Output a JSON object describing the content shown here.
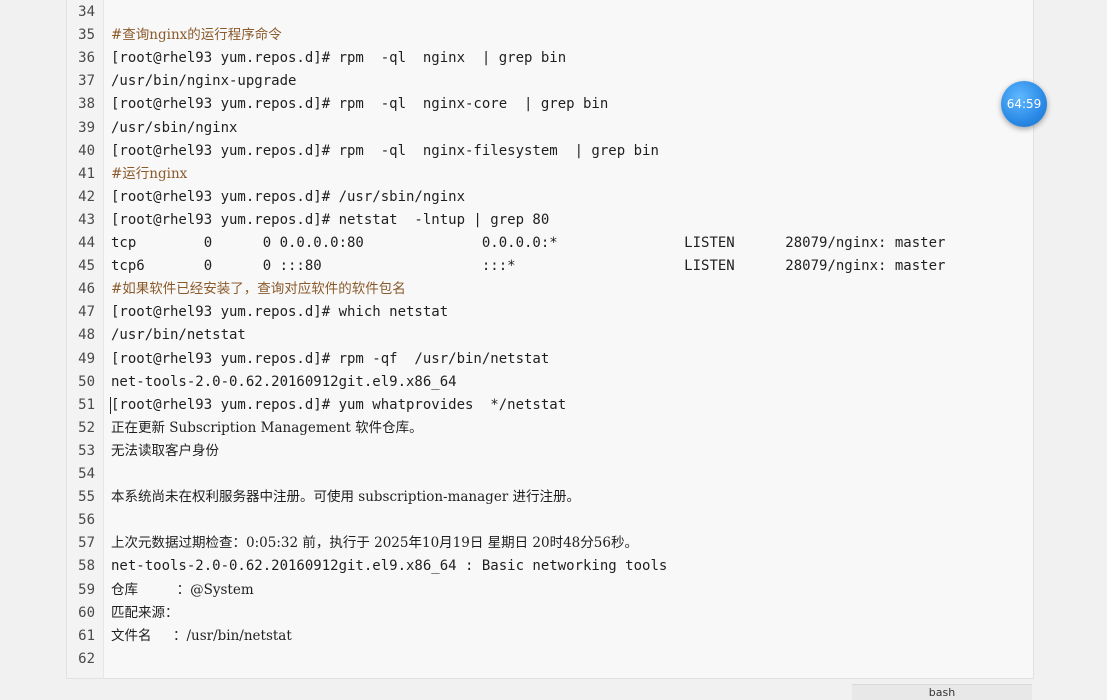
{
  "editor": {
    "lines": [
      {
        "n": "34",
        "t": ""
      },
      {
        "n": "35",
        "t": "#查询nginx的运行程序命令"
      },
      {
        "n": "36",
        "t": "[root@rhel93 yum.repos.d]# rpm  -ql  nginx  | grep bin"
      },
      {
        "n": "37",
        "t": "/usr/bin/nginx-upgrade"
      },
      {
        "n": "38",
        "t": "[root@rhel93 yum.repos.d]# rpm  -ql  nginx-core  | grep bin"
      },
      {
        "n": "39",
        "t": "/usr/sbin/nginx"
      },
      {
        "n": "40",
        "t": "[root@rhel93 yum.repos.d]# rpm  -ql  nginx-filesystem  | grep bin"
      },
      {
        "n": "41",
        "t": "#运行nginx"
      },
      {
        "n": "42",
        "t": "[root@rhel93 yum.repos.d]# /usr/sbin/nginx"
      },
      {
        "n": "43",
        "t": "[root@rhel93 yum.repos.d]# netstat  -lntup | grep 80"
      },
      {
        "n": "44",
        "t": "tcp        0      0 0.0.0.0:80              0.0.0.0:*               LISTEN      28079/nginx: master"
      },
      {
        "n": "45",
        "t": "tcp6       0      0 :::80                   :::*                    LISTEN      28079/nginx: master"
      },
      {
        "n": "46",
        "t": "#如果软件已经安装了，查询对应软件的软件包名"
      },
      {
        "n": "47",
        "t": "[root@rhel93 yum.repos.d]# which netstat"
      },
      {
        "n": "48",
        "t": "/usr/bin/netstat"
      },
      {
        "n": "49",
        "t": "[root@rhel93 yum.repos.d]# rpm -qf  /usr/bin/netstat"
      },
      {
        "n": "50",
        "t": "net-tools-2.0-0.62.20160912git.el9.x86_64"
      },
      {
        "n": "51",
        "t": "[root@rhel93 yum.repos.d]# yum whatprovides  */netstat"
      },
      {
        "n": "52",
        "t": "正在更新 Subscription Management 软件仓库。"
      },
      {
        "n": "53",
        "t": "无法读取客户身份"
      },
      {
        "n": "54",
        "t": ""
      },
      {
        "n": "55",
        "t": "本系统尚未在权利服务器中注册。可使用 subscription-manager 进行注册。"
      },
      {
        "n": "56",
        "t": ""
      },
      {
        "n": "57",
        "t": "上次元数据过期检查：0:05:32 前，执行于 2025年10月19日 星期日 20时48分56秒。"
      },
      {
        "n": "58",
        "t": "net-tools-2.0-0.62.20160912git.el9.x86_64 : Basic networking tools"
      },
      {
        "n": "59",
        "t": "仓库         ：@System"
      },
      {
        "n": "60",
        "t": "匹配来源："
      },
      {
        "n": "61",
        "t": "文件名     ：/usr/bin/netstat"
      },
      {
        "n": "62",
        "t": ""
      }
    ]
  },
  "timer": {
    "label": "64:59"
  },
  "statusbar": {
    "label": "bash"
  }
}
